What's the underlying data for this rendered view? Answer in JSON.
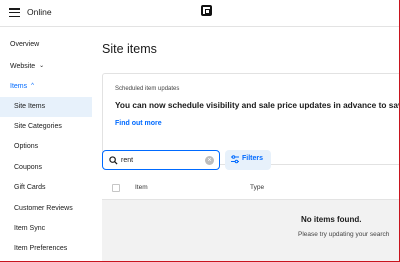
{
  "topbar": {
    "app_title": "Online",
    "menu_icon": "hamburger-icon",
    "logo_icon": "square-logo-icon"
  },
  "sidebar": {
    "items": [
      {
        "label": "Overview"
      },
      {
        "label": "Website",
        "caret": "⌄"
      },
      {
        "label": "Items",
        "caret": "^"
      },
      {
        "label": "Site Items"
      },
      {
        "label": "Site Categories"
      },
      {
        "label": "Options"
      },
      {
        "label": "Coupons"
      },
      {
        "label": "Gift Cards"
      },
      {
        "label": "Customer Reviews"
      },
      {
        "label": "Item Sync"
      },
      {
        "label": "Item Preferences"
      }
    ]
  },
  "main": {
    "title": "Site items",
    "banner": {
      "eyebrow": "Scheduled item updates",
      "headline": "You can now schedule visibility and sale price updates in advance to save ti",
      "link": "Find out more"
    },
    "search": {
      "value": "rent",
      "icon": "search-icon",
      "clear_icon": "clear-icon"
    },
    "filters": {
      "label": "Filters",
      "icon": "sliders-icon"
    },
    "table": {
      "columns": [
        "Item",
        "Type"
      ]
    },
    "empty_state": {
      "title": "No items found.",
      "subtitle": "Please try updating your search"
    }
  },
  "colors": {
    "accent": "#006aff",
    "active_bg": "#e7f1fb",
    "frame_border": "#c8141e"
  }
}
